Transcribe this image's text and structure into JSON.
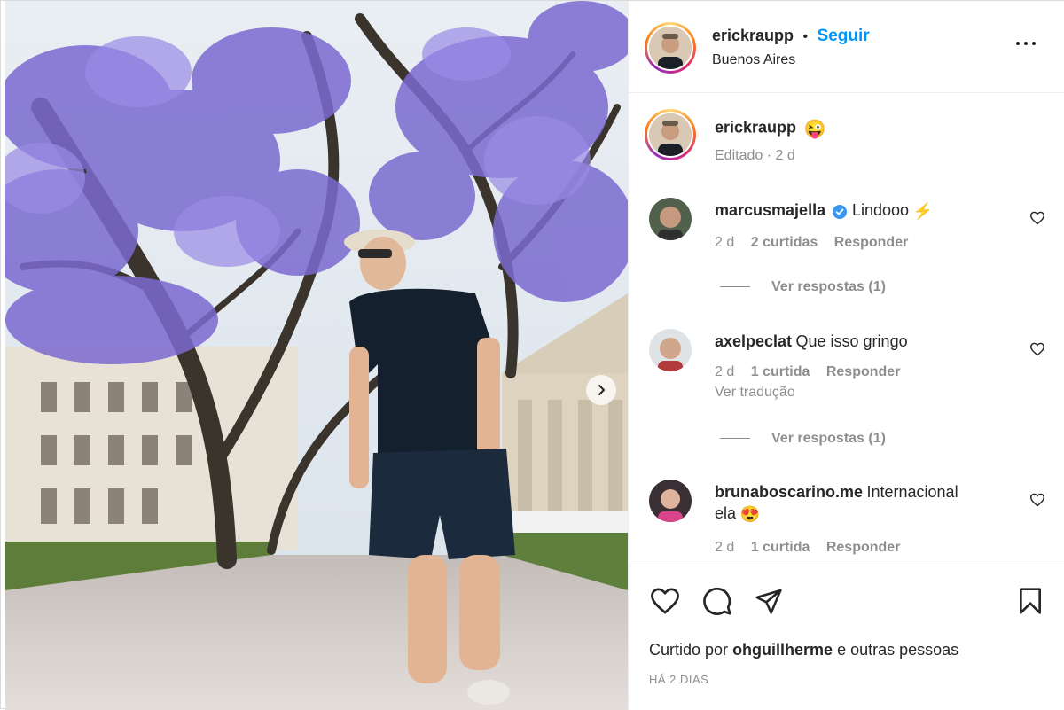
{
  "header": {
    "username": "erickraupp",
    "separator": "•",
    "follow_label": "Seguir",
    "location": "Buenos Aires"
  },
  "caption": {
    "username": "erickraupp",
    "emoji": "😜",
    "meta": "Editado · 2 d"
  },
  "comments": [
    {
      "username": "marcusmajella",
      "verified": true,
      "text": "Lindooo",
      "emoji": "⚡",
      "time": "2 d",
      "likes": "2 curtidas",
      "reply_label": "Responder",
      "view_replies": "Ver respostas (1)"
    },
    {
      "username": "axelpeclat",
      "verified": false,
      "text": "Que isso gringo",
      "time": "2 d",
      "likes": "1 curtida",
      "reply_label": "Responder",
      "translate": "Ver tradução",
      "view_replies": "Ver respostas (1)"
    },
    {
      "username": "brunaboscarino.me",
      "verified": false,
      "text": "Internacional",
      "text2": "ela",
      "emoji": "😍",
      "time": "2 d",
      "likes": "1 curtida",
      "reply_label": "Responder"
    }
  ],
  "actions": {
    "icons": [
      "heart-icon",
      "comment-icon",
      "share-icon",
      "bookmark-icon"
    ],
    "liked_by_prefix": "Curtido por",
    "liked_by_user": "ohguillherme",
    "liked_by_suffix": "e outras pessoas",
    "posted_ago": "HÁ 2 DIAS"
  },
  "colors": {
    "accent": "#0095f6",
    "secondary_text": "#8e8e8e",
    "primary_text": "#262626"
  }
}
